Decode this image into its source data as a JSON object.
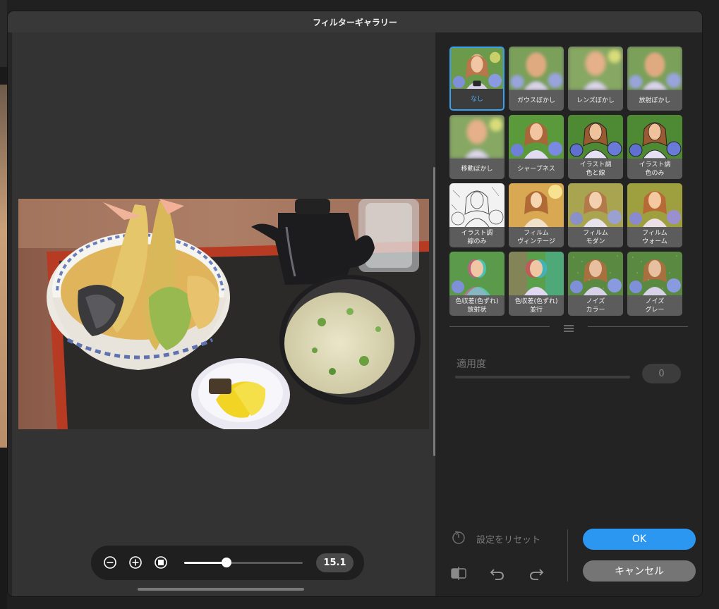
{
  "window": {
    "title": "フィルターギャラリー"
  },
  "preview": {
    "zoom_value": "15.1",
    "zoom_fraction": 0.36
  },
  "filters": [
    {
      "label": "なし",
      "selected": true,
      "style": "plain"
    },
    {
      "label": "ガウスぼかし",
      "selected": false,
      "style": "blur"
    },
    {
      "label": "レンズぼかし",
      "selected": false,
      "style": "blur2"
    },
    {
      "label": "放射ぼかし",
      "selected": false,
      "style": "blur"
    },
    {
      "label": "移動ぼかし",
      "selected": false,
      "style": "blur2"
    },
    {
      "label": "シャープネス",
      "selected": false,
      "style": "sharp"
    },
    {
      "label": "イラスト調\n色と線",
      "selected": false,
      "style": "illust"
    },
    {
      "label": "イラスト調\n色のみ",
      "selected": false,
      "style": "illust"
    },
    {
      "label": "イラスト調\n線のみ",
      "selected": false,
      "style": "lines"
    },
    {
      "label": "フィルム\nヴィンテージ",
      "selected": false,
      "style": "vintage"
    },
    {
      "label": "フィルム\nモダン",
      "selected": false,
      "style": "modern"
    },
    {
      "label": "フィルム\nウォーム",
      "selected": false,
      "style": "warm"
    },
    {
      "label": "色収差(色ずれ)\n放射状",
      "selected": false,
      "style": "chroma"
    },
    {
      "label": "色収差(色ずれ)\n並行",
      "selected": false,
      "style": "chroma2"
    },
    {
      "label": "ノイズ\nカラー",
      "selected": false,
      "style": "noise"
    },
    {
      "label": "ノイズ\nグレー",
      "selected": false,
      "style": "noise"
    }
  ],
  "intensity": {
    "label": "適用度",
    "value": "0"
  },
  "reset": {
    "label": "設定をリセット"
  },
  "buttons": {
    "ok": "OK",
    "cancel": "キャンセル"
  },
  "colors": {
    "accent": "#2b97f0",
    "cancel": "#757575"
  }
}
